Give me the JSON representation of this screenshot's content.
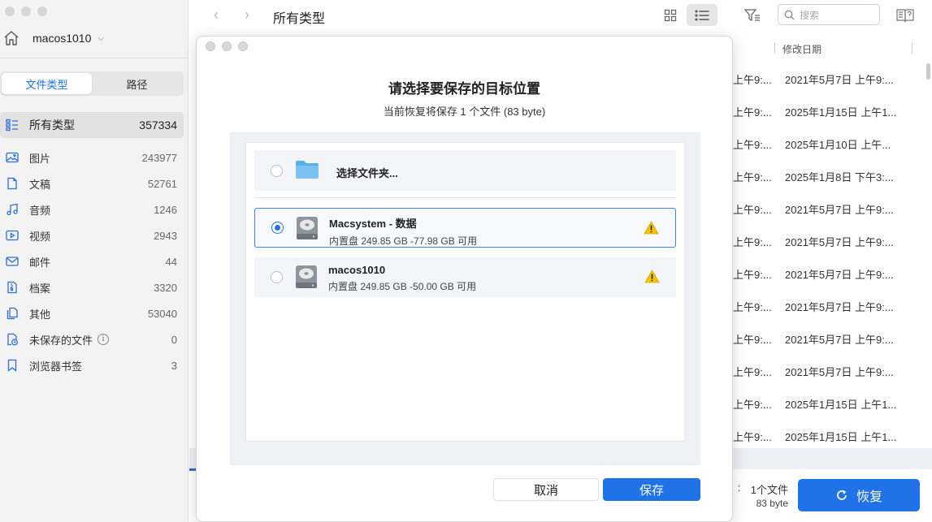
{
  "sidebar": {
    "device_name": "macos1010",
    "tabs": [
      {
        "label": "文件类型",
        "active": true
      },
      {
        "label": "路径",
        "active": false
      }
    ],
    "all": {
      "label": "所有类型",
      "count": "357334"
    },
    "categories": [
      {
        "label": "图片",
        "count": "243977",
        "icon": "image-icon"
      },
      {
        "label": "文稿",
        "count": "52761",
        "icon": "document-icon"
      },
      {
        "label": "音频",
        "count": "1246",
        "icon": "music-note-icon"
      },
      {
        "label": "视频",
        "count": "2943",
        "icon": "video-icon"
      },
      {
        "label": "邮件",
        "count": "44",
        "icon": "mail-icon"
      },
      {
        "label": "档案",
        "count": "3320",
        "icon": "archive-icon"
      },
      {
        "label": "其他",
        "count": "53040",
        "icon": "other-files-icon"
      },
      {
        "label": "未保存的文件",
        "count": "0",
        "icon": "unsaved-clock-icon"
      },
      {
        "label": "浏览器书签",
        "count": "3",
        "icon": "bookmark-icon"
      }
    ]
  },
  "toolbar": {
    "title": "所有类型",
    "search_placeholder": "搜索"
  },
  "table": {
    "modified_header": "修改日期",
    "rows": [
      {
        "time": "上午9:...",
        "modified": "2021年5月7日 上午9:..."
      },
      {
        "time": "上午9:...",
        "modified": "2025年1月15日 上午1..."
      },
      {
        "time": "上午9:...",
        "modified": "2025年1月10日 上午..."
      },
      {
        "time": "上午9:...",
        "modified": "2025年1月8日 下午3:..."
      },
      {
        "time": "上午9:...",
        "modified": "2021年5月7日 上午9:..."
      },
      {
        "time": "上午9:...",
        "modified": "2021年5月7日 上午9:..."
      },
      {
        "time": "上午9:...",
        "modified": "2021年5月7日 上午9:..."
      },
      {
        "time": "上午9:...",
        "modified": "2021年5月7日 上午9:..."
      },
      {
        "time": "上午9:...",
        "modified": "2021年5月7日 上午9:..."
      },
      {
        "time": "上午9:...",
        "modified": "2021年5月7日 上午9:..."
      },
      {
        "time": "上午9:...",
        "modified": "2025年1月15日 上午1..."
      },
      {
        "time": "上午9:...",
        "modified": "2025年1月15日 上午1..."
      }
    ]
  },
  "footer": {
    "selected_count": "1个文件",
    "selected_size": "83 byte",
    "recover_label": "恢复"
  },
  "dialog": {
    "title": "请选择要保存的目标位置",
    "subtitle": "当前恢复将保存 1 个文件 (83 byte)",
    "choose_folder": "选择文件夹...",
    "volumes": [
      {
        "name": "Macsystem - 数据",
        "detail": "内置盘 249.85 GB -77.98 GB 可用",
        "selected": true
      },
      {
        "name": "macos1010",
        "detail": "内置盘 249.85 GB -50.00 GB 可用",
        "selected": false
      }
    ],
    "cancel_label": "取消",
    "save_label": "保存"
  },
  "colors": {
    "accent": "#1f72e8",
    "warning": "#f5c400"
  }
}
